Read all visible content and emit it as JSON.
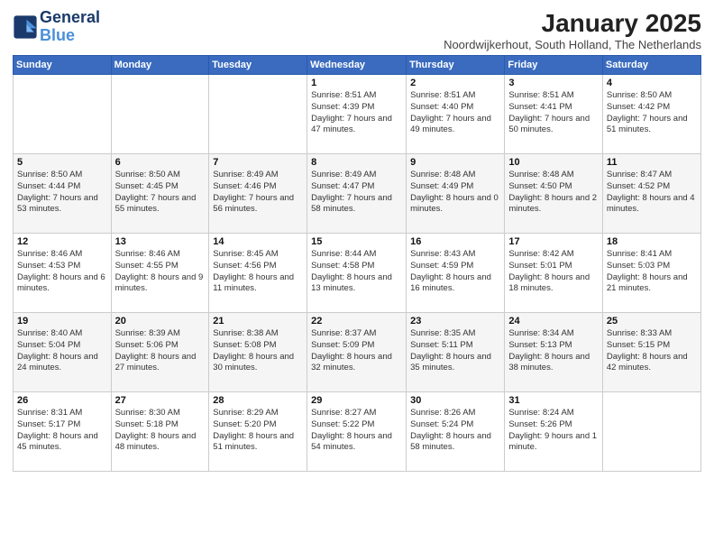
{
  "logo": {
    "line1": "General",
    "line2": "Blue"
  },
  "title": "January 2025",
  "subtitle": "Noordwijkerhout, South Holland, The Netherlands",
  "weekdays": [
    "Sunday",
    "Monday",
    "Tuesday",
    "Wednesday",
    "Thursday",
    "Friday",
    "Saturday"
  ],
  "weeks": [
    [
      {
        "day": "",
        "info": ""
      },
      {
        "day": "",
        "info": ""
      },
      {
        "day": "",
        "info": ""
      },
      {
        "day": "1",
        "info": "Sunrise: 8:51 AM\nSunset: 4:39 PM\nDaylight: 7 hours and 47 minutes."
      },
      {
        "day": "2",
        "info": "Sunrise: 8:51 AM\nSunset: 4:40 PM\nDaylight: 7 hours and 49 minutes."
      },
      {
        "day": "3",
        "info": "Sunrise: 8:51 AM\nSunset: 4:41 PM\nDaylight: 7 hours and 50 minutes."
      },
      {
        "day": "4",
        "info": "Sunrise: 8:50 AM\nSunset: 4:42 PM\nDaylight: 7 hours and 51 minutes."
      }
    ],
    [
      {
        "day": "5",
        "info": "Sunrise: 8:50 AM\nSunset: 4:44 PM\nDaylight: 7 hours and 53 minutes."
      },
      {
        "day": "6",
        "info": "Sunrise: 8:50 AM\nSunset: 4:45 PM\nDaylight: 7 hours and 55 minutes."
      },
      {
        "day": "7",
        "info": "Sunrise: 8:49 AM\nSunset: 4:46 PM\nDaylight: 7 hours and 56 minutes."
      },
      {
        "day": "8",
        "info": "Sunrise: 8:49 AM\nSunset: 4:47 PM\nDaylight: 7 hours and 58 minutes."
      },
      {
        "day": "9",
        "info": "Sunrise: 8:48 AM\nSunset: 4:49 PM\nDaylight: 8 hours and 0 minutes."
      },
      {
        "day": "10",
        "info": "Sunrise: 8:48 AM\nSunset: 4:50 PM\nDaylight: 8 hours and 2 minutes."
      },
      {
        "day": "11",
        "info": "Sunrise: 8:47 AM\nSunset: 4:52 PM\nDaylight: 8 hours and 4 minutes."
      }
    ],
    [
      {
        "day": "12",
        "info": "Sunrise: 8:46 AM\nSunset: 4:53 PM\nDaylight: 8 hours and 6 minutes."
      },
      {
        "day": "13",
        "info": "Sunrise: 8:46 AM\nSunset: 4:55 PM\nDaylight: 8 hours and 9 minutes."
      },
      {
        "day": "14",
        "info": "Sunrise: 8:45 AM\nSunset: 4:56 PM\nDaylight: 8 hours and 11 minutes."
      },
      {
        "day": "15",
        "info": "Sunrise: 8:44 AM\nSunset: 4:58 PM\nDaylight: 8 hours and 13 minutes."
      },
      {
        "day": "16",
        "info": "Sunrise: 8:43 AM\nSunset: 4:59 PM\nDaylight: 8 hours and 16 minutes."
      },
      {
        "day": "17",
        "info": "Sunrise: 8:42 AM\nSunset: 5:01 PM\nDaylight: 8 hours and 18 minutes."
      },
      {
        "day": "18",
        "info": "Sunrise: 8:41 AM\nSunset: 5:03 PM\nDaylight: 8 hours and 21 minutes."
      }
    ],
    [
      {
        "day": "19",
        "info": "Sunrise: 8:40 AM\nSunset: 5:04 PM\nDaylight: 8 hours and 24 minutes."
      },
      {
        "day": "20",
        "info": "Sunrise: 8:39 AM\nSunset: 5:06 PM\nDaylight: 8 hours and 27 minutes."
      },
      {
        "day": "21",
        "info": "Sunrise: 8:38 AM\nSunset: 5:08 PM\nDaylight: 8 hours and 30 minutes."
      },
      {
        "day": "22",
        "info": "Sunrise: 8:37 AM\nSunset: 5:09 PM\nDaylight: 8 hours and 32 minutes."
      },
      {
        "day": "23",
        "info": "Sunrise: 8:35 AM\nSunset: 5:11 PM\nDaylight: 8 hours and 35 minutes."
      },
      {
        "day": "24",
        "info": "Sunrise: 8:34 AM\nSunset: 5:13 PM\nDaylight: 8 hours and 38 minutes."
      },
      {
        "day": "25",
        "info": "Sunrise: 8:33 AM\nSunset: 5:15 PM\nDaylight: 8 hours and 42 minutes."
      }
    ],
    [
      {
        "day": "26",
        "info": "Sunrise: 8:31 AM\nSunset: 5:17 PM\nDaylight: 8 hours and 45 minutes."
      },
      {
        "day": "27",
        "info": "Sunrise: 8:30 AM\nSunset: 5:18 PM\nDaylight: 8 hours and 48 minutes."
      },
      {
        "day": "28",
        "info": "Sunrise: 8:29 AM\nSunset: 5:20 PM\nDaylight: 8 hours and 51 minutes."
      },
      {
        "day": "29",
        "info": "Sunrise: 8:27 AM\nSunset: 5:22 PM\nDaylight: 8 hours and 54 minutes."
      },
      {
        "day": "30",
        "info": "Sunrise: 8:26 AM\nSunset: 5:24 PM\nDaylight: 8 hours and 58 minutes."
      },
      {
        "day": "31",
        "info": "Sunrise: 8:24 AM\nSunset: 5:26 PM\nDaylight: 9 hours and 1 minute."
      },
      {
        "day": "",
        "info": ""
      }
    ]
  ]
}
